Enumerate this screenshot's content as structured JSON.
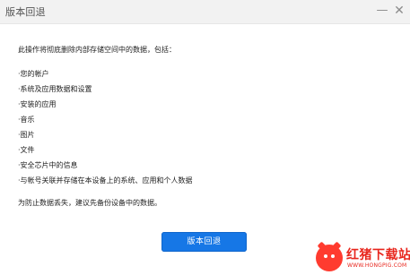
{
  "window": {
    "title": "版本回退",
    "minimize_glyph": "—",
    "close_glyph": "✕"
  },
  "content": {
    "intro": "此操作将彻底删除内部存储空间中的数据，包括：",
    "items": [
      "·您的帐户",
      "·系统及应用数据和设置",
      "·安装的应用",
      "·音乐",
      "·图片",
      "·文件",
      "·安全芯片中的信息",
      "·与帐号关联并存储在本设备上的系统、应用和个人数据"
    ],
    "advice": "为防止数据丢失，建议先备份设备中的数据。"
  },
  "actions": {
    "primary_label": "版本回退"
  },
  "watermark": {
    "name": "红猪下载站",
    "url": "WWW.HONGPIG.COM"
  },
  "colors": {
    "accent": "#1677e6",
    "watermark": "#e8261d"
  }
}
